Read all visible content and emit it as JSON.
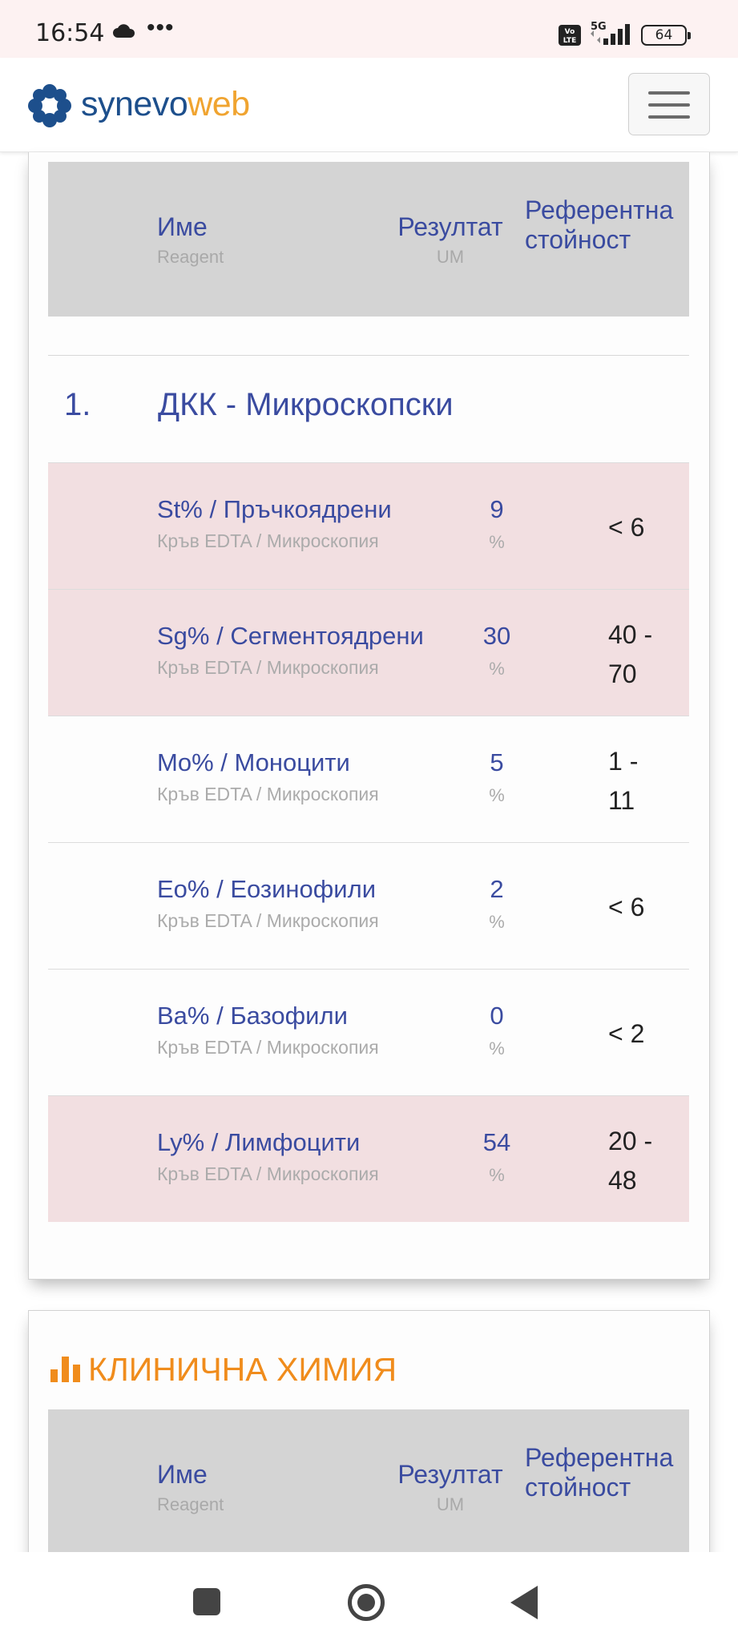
{
  "status_bar": {
    "time": "16:54",
    "dots": "•••",
    "volte": "Vo LTE",
    "network": "5G",
    "battery": "64",
    "icons": [
      "cloud-icon",
      "volte-icon",
      "signal-icon",
      "battery-icon"
    ]
  },
  "header": {
    "logo_part1": "synevo",
    "logo_part2": "web",
    "brand_colors": {
      "primary": "#1d4f8c",
      "accent": "#f0a430"
    },
    "menu_icon": "hamburger-icon"
  },
  "table_header": {
    "name_label": "Име",
    "name_sub": "Reagent",
    "result_label": "Резултат",
    "result_sub": "UM",
    "ref_label": "Референтна стойност"
  },
  "group": {
    "number": "1.",
    "name": "ДКК - Микроскопски"
  },
  "rows": [
    {
      "name": "St% / Пръчкоядрени",
      "method": "Кръв EDTA / Микроскопия",
      "value": "9",
      "unit": "%",
      "ref_line1": "< 6",
      "ref_line2": "",
      "abnormal": true
    },
    {
      "name": "Sg% / Сегментоядрени",
      "method": "Кръв EDTA / Микроскопия",
      "value": "30",
      "unit": "%",
      "ref_line1": "40 -",
      "ref_line2": "70",
      "abnormal": true
    },
    {
      "name": "Mo% / Моноцити",
      "method": "Кръв EDTA / Микроскопия",
      "value": "5",
      "unit": "%",
      "ref_line1": "1 -",
      "ref_line2": "11",
      "abnormal": false
    },
    {
      "name": "Eo% / Еозинофили",
      "method": "Кръв EDTA / Микроскопия",
      "value": "2",
      "unit": "%",
      "ref_line1": "< 6",
      "ref_line2": "",
      "abnormal": false
    },
    {
      "name": "Ba% / Базофили",
      "method": "Кръв EDTA / Микроскопия",
      "value": "0",
      "unit": "%",
      "ref_line1": "< 2",
      "ref_line2": "",
      "abnormal": false
    },
    {
      "name": "Ly% / Лимфоцити",
      "method": "Кръв EDTA / Микроскопия",
      "value": "54",
      "unit": "%",
      "ref_line1": "20 -",
      "ref_line2": "48",
      "abnormal": true
    }
  ],
  "section2": {
    "title": "КЛИНИЧНА ХИМИЯ",
    "icon": "bar-chart-icon"
  },
  "colors": {
    "link_blue": "#3a4ba0",
    "abnormal_row": "#f2dfe1",
    "header_gray": "#d4d4d4",
    "section_orange": "#f08c1c"
  }
}
